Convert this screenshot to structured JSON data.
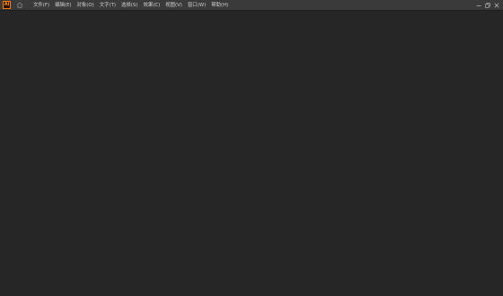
{
  "app": {
    "logo_text": "Ai",
    "logo_color": "#ff7c00"
  },
  "menu": {
    "items": [
      {
        "label": "文件(F)"
      },
      {
        "label": "编辑(E)"
      },
      {
        "label": "对象(O)"
      },
      {
        "label": "文字(T)"
      },
      {
        "label": "选择(S)"
      },
      {
        "label": "效果(C)"
      },
      {
        "label": "视图(V)"
      },
      {
        "label": "窗口(W)"
      },
      {
        "label": "帮助(H)"
      }
    ]
  },
  "window_controls": {
    "icons": [
      "minimize-icon",
      "restore-icon",
      "close-icon"
    ]
  },
  "colors": {
    "titlebar_bg": "#3a3a3a",
    "workspace_bg": "#262626",
    "menu_text": "#d2d2d2"
  }
}
